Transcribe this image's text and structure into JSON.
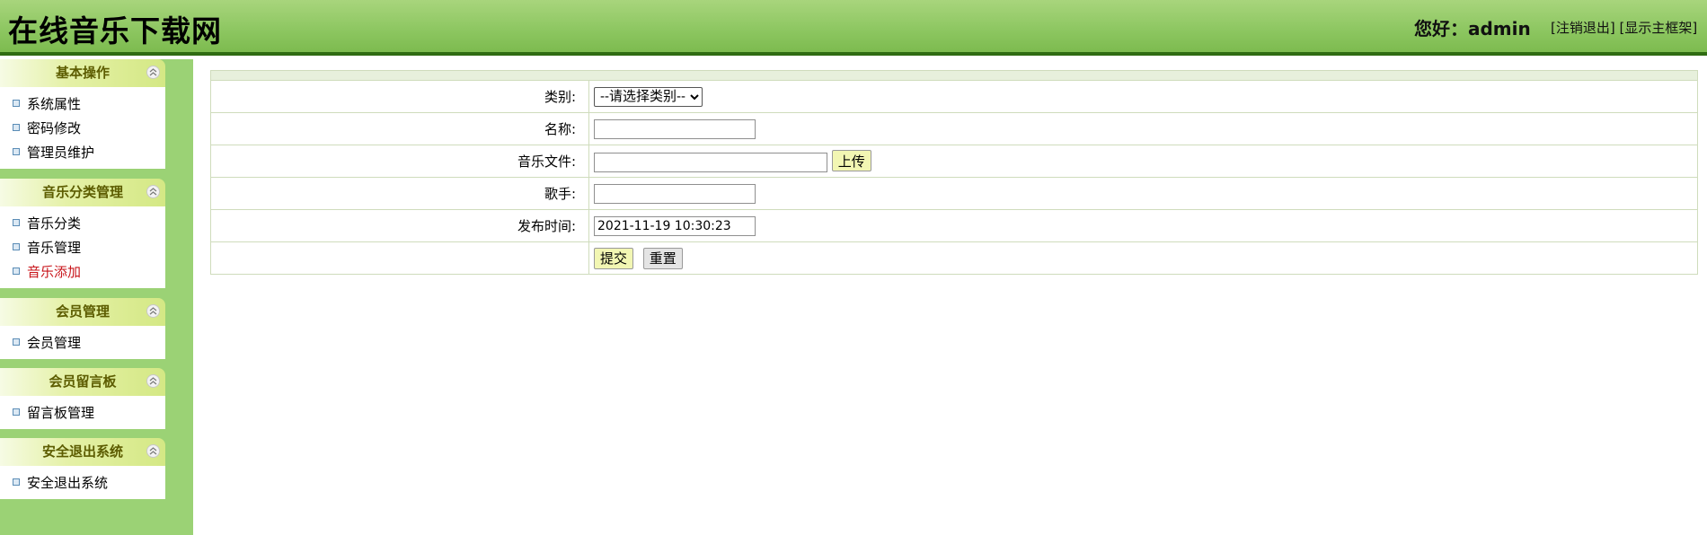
{
  "header": {
    "title": "在线音乐下载网",
    "greeting": "您好：admin",
    "links": [
      "[注销退出]",
      "[显示主框架]"
    ]
  },
  "sidebar": {
    "groups": [
      {
        "title": "基本操作",
        "items": [
          "系统属性",
          "密码修改",
          "管理员维护"
        ]
      },
      {
        "title": "音乐分类管理",
        "items": [
          "音乐分类",
          "音乐管理",
          "音乐添加"
        ],
        "active_item": "音乐添加"
      },
      {
        "title": "会员管理",
        "items": [
          "会员管理"
        ]
      },
      {
        "title": "会员留言板",
        "items": [
          "留言板管理"
        ]
      },
      {
        "title": "安全退出系统",
        "items": [
          "安全退出系统"
        ]
      }
    ],
    "collapse_icon": "double-chevron-up-icon",
    "bullet_icon": "square-bullet-icon"
  },
  "form": {
    "category_label": "类别:",
    "category_selected": "--请选择类别--",
    "name_label": "名称:",
    "name_value": "",
    "file_label": "音乐文件:",
    "file_value": "",
    "upload_label": "上传",
    "singer_label": "歌手:",
    "singer_value": "",
    "publish_label": "发布时间:",
    "publish_value": "2021-11-19 10:30:23",
    "submit_label": "提交",
    "reset_label": "重置"
  },
  "colors": {
    "header_green": "#8cc660",
    "header_border": "#2f6b12",
    "sidebar_green": "#9bd275",
    "active_link": "#c8141a"
  }
}
